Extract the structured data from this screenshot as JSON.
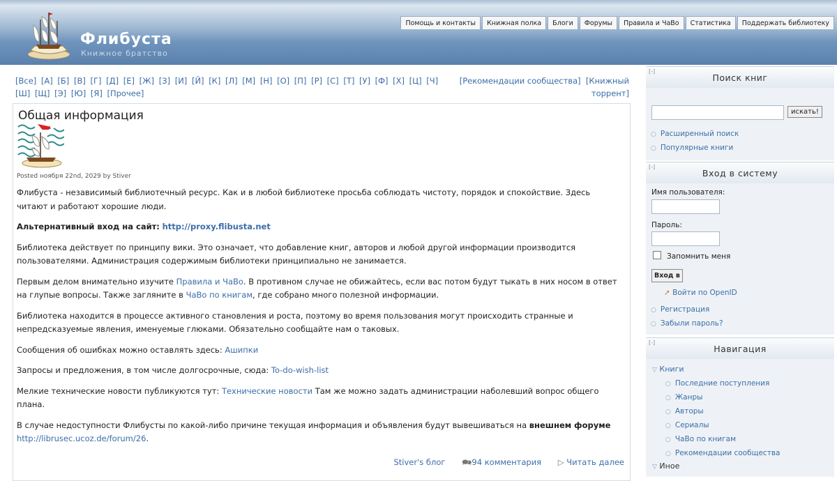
{
  "header": {
    "site_name": "Флибуста",
    "slogan": "Книжное братство",
    "nav": [
      "Помощь и контакты",
      "Книжная полка",
      "Блоги",
      "Форумы",
      "Правила и ЧаВо",
      "Статистика",
      "Поддержать библиотеку"
    ]
  },
  "letters": [
    "[Все]",
    "[А]",
    "[Б]",
    "[В]",
    "[Г]",
    "[Д]",
    "[Е]",
    "[Ж]",
    "[З]",
    "[И]",
    "[Й]",
    "[К]",
    "[Л]",
    "[М]",
    "[Н]",
    "[О]",
    "[П]",
    "[Р]",
    "[С]",
    "[Т]",
    "[У]",
    "[Ф]",
    "[Х]",
    "[Ц]",
    "[Ч]",
    "[Ш]",
    "[Щ]",
    "[Э]",
    "[Ю]",
    "[Я]",
    "[Прочее]"
  ],
  "rec_links": {
    "recommendations": "[Рекомендации сообщества]",
    "torrent": "[Книжный торрент]"
  },
  "post": {
    "title": "Общая информация",
    "meta": "Posted ноября 22nd, 2029 by Stiver",
    "p1": "Флибуста - независимый библиотечный ресурс. Как и в любой библиотеке просьба соблюдать чистоту, порядок и спокойствие. Здесь читают и работают хорошие люди.",
    "alt_label": "Альтернативный вход на сайт:",
    "alt_url": "http://proxy.flibusta.net",
    "p3": "Библиотека действует по принципу вики. Это означает, что добавление книг, авторов и любой другой информации производится пользователями. Администрация содержимым библиотеки принципиально не занимается.",
    "p4_a": "Первым делом внимательно изучите",
    "p4_link1": "Правила и ЧаВо",
    "p4_b": ". В противном случае не обижайтесь, если вас потом будут тыкать в них носом в ответ на глупые вопросы. Также загляните в",
    "p4_link2": "ЧаВо по книгам",
    "p4_c": ", где собрано много полезной информации.",
    "p5": "Библиотека находится в процессе активного становления и роста, поэтому во время пользования могут происходить странные и непредсказуемые явления, именуемые глюками. Обязательно сообщайте нам о таковых.",
    "p6_text": "Сообщения об ошибках можно оставлять здесь:",
    "p6_link": "Ашипки",
    "p7_text": "Запросы и предложения, в том числе долгосрочные, сюда:",
    "p7_link": "To-do-wish-list",
    "p8_a": "Мелкие технические новости публикуются тут:",
    "p8_link": "Технические новости",
    "p8_b": "Там же можно задать администрации наболевший вопрос общего плана.",
    "p9_a": "В случае недоступности Флибусты по какой-либо причине текущая информация и объявления будут вывешиваться на",
    "p9_bold": "внешнем форуме",
    "p9_link": "http://librusec.ucoz.de/forum/26",
    "p9_end": ".",
    "blog_link": "Stiver's блог",
    "comments_link": "94 комментария",
    "read_more": "Читать далее"
  },
  "sidebar": {
    "toggle": "[-]",
    "search": {
      "title": "Поиск книг",
      "button": "искать!",
      "links": [
        "Расширенный поиск",
        "Популярные книги"
      ]
    },
    "login": {
      "title": "Вход в систему",
      "username_label": "Имя пользователя:",
      "password_label": "Пароль:",
      "remember": "Запомнить меня",
      "submit": "Вход в",
      "openid": "Войти по OpenID",
      "links": [
        "Регистрация",
        "Забыли пароль?"
      ]
    },
    "nav": {
      "title": "Навигация",
      "books": "Книги",
      "book_items": [
        "Последние поступления",
        "Жанры",
        "Авторы",
        "Сериалы",
        "ЧаВо по книгам",
        "Рекомендации сообщества"
      ],
      "other": "Иное"
    }
  }
}
